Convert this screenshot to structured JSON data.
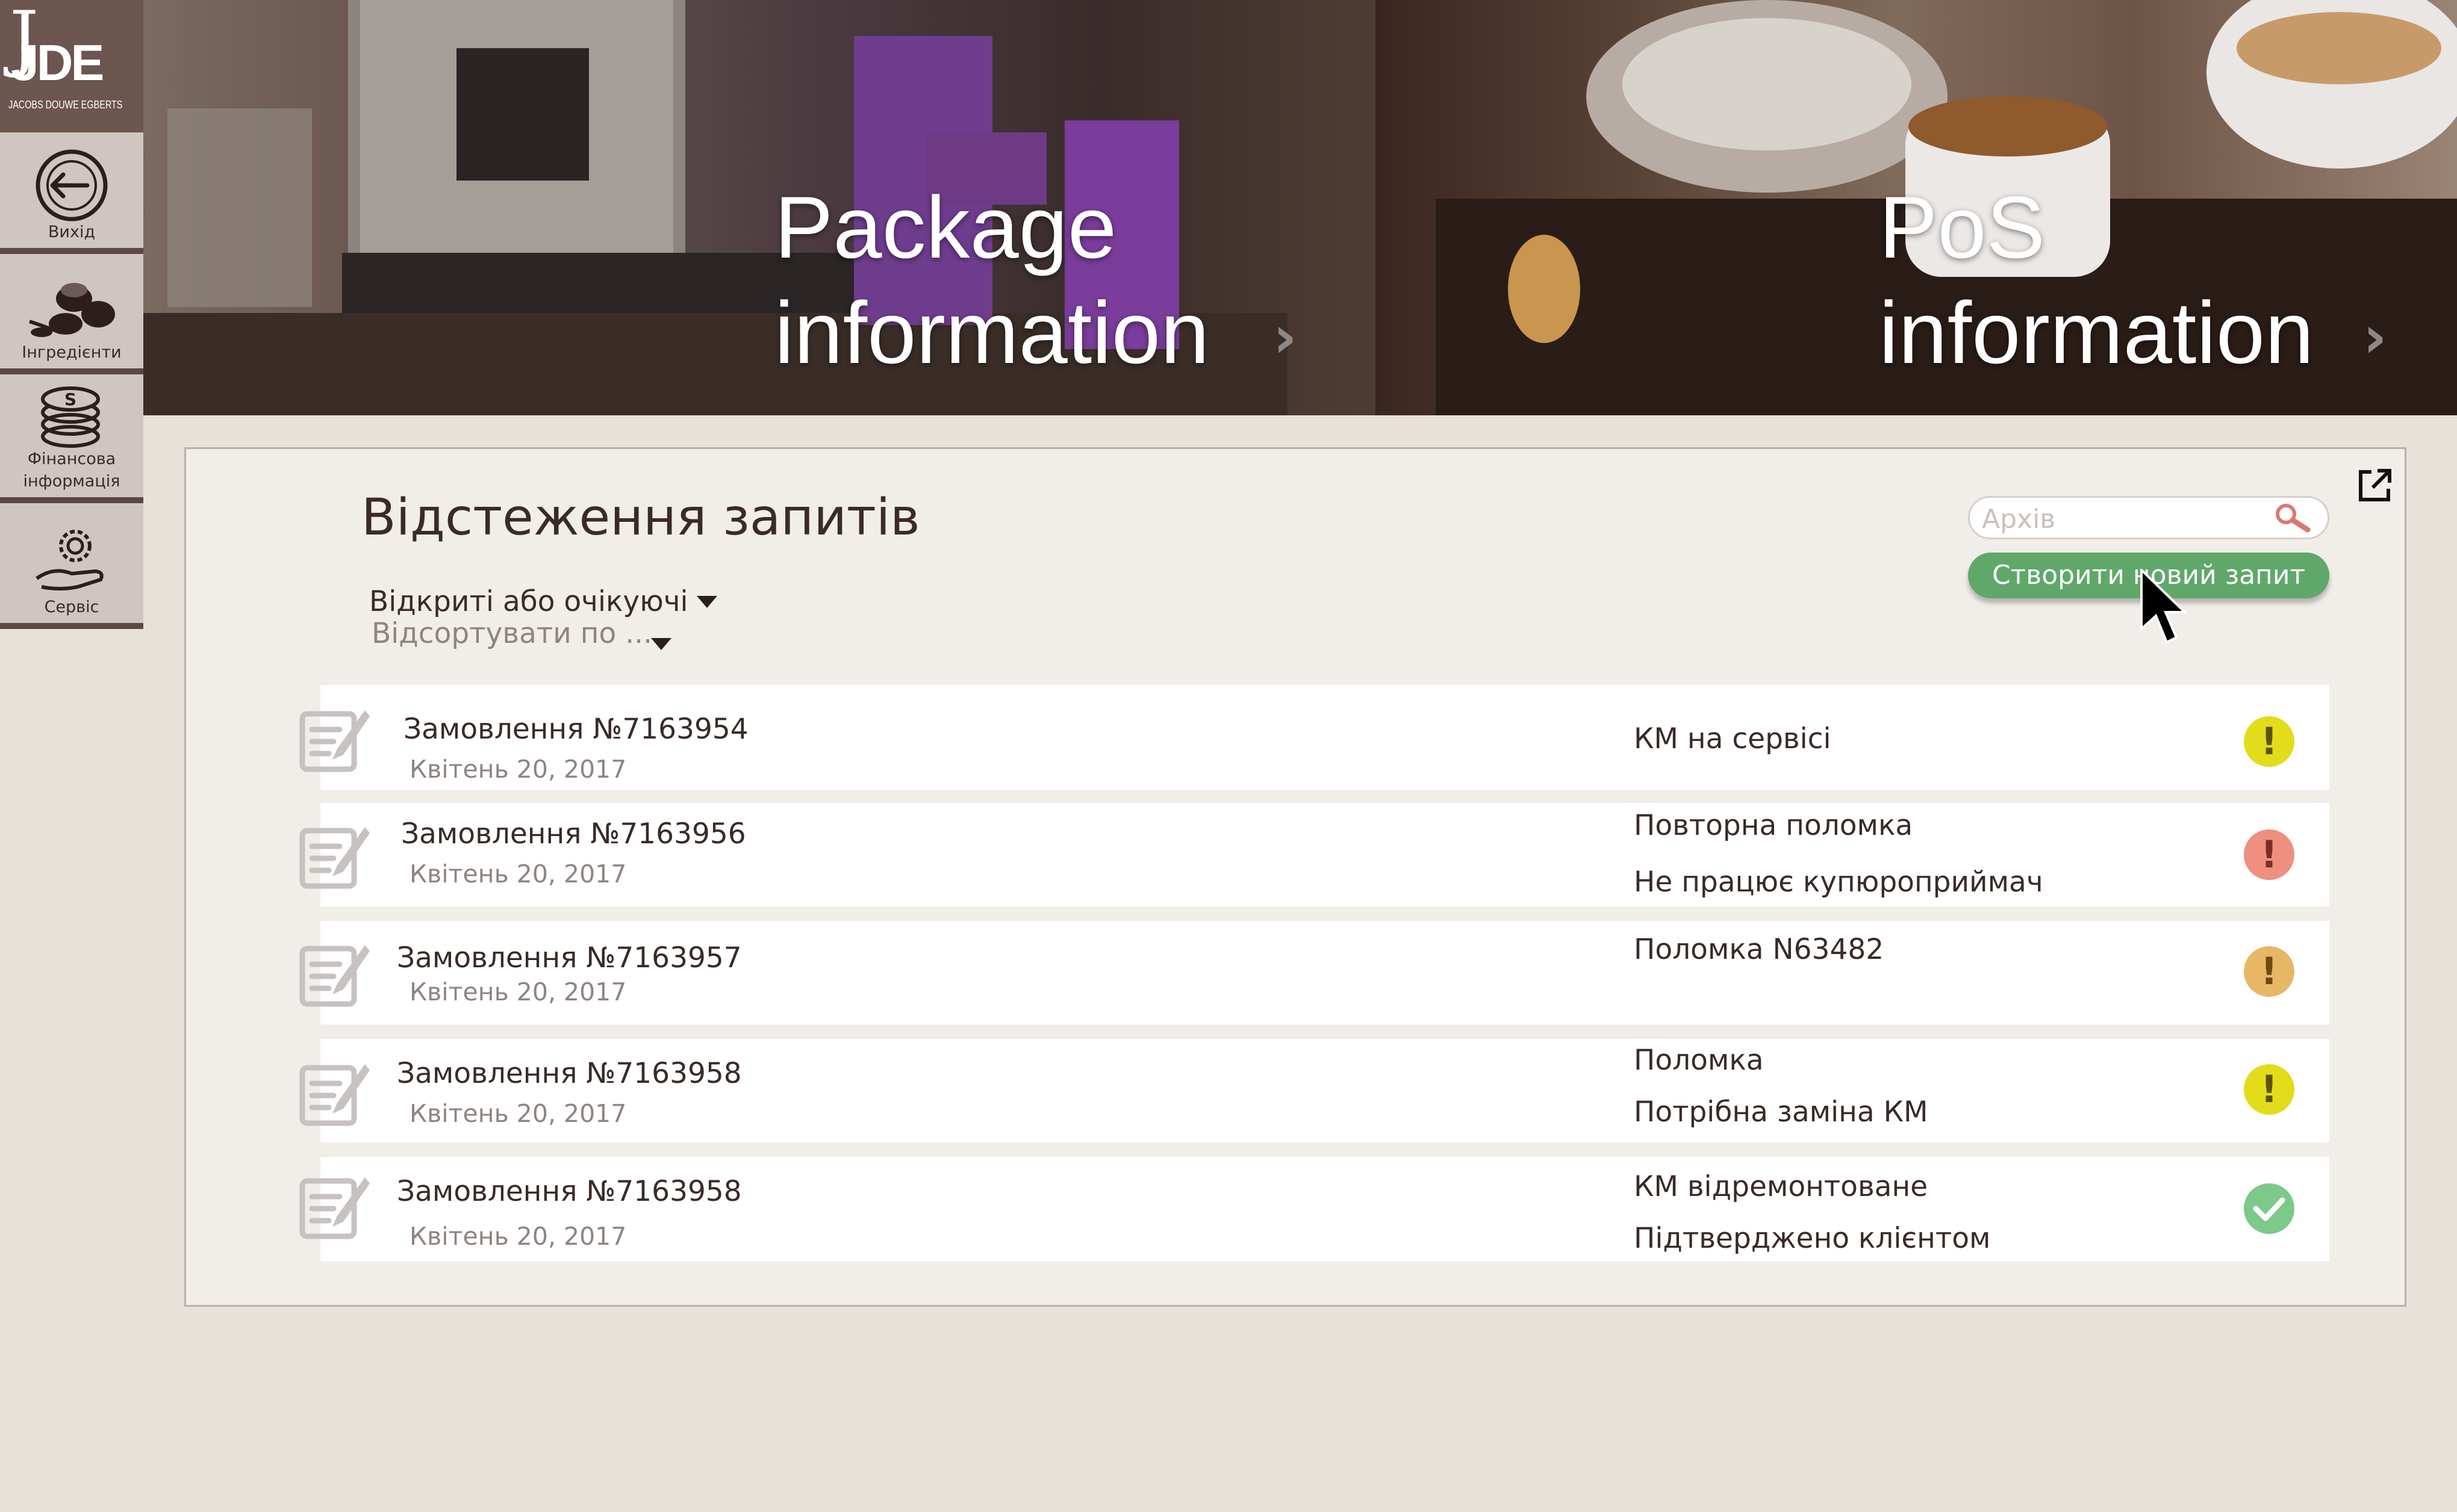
{
  "brand": {
    "logo_text": "JDE",
    "logo_subtitle": "JACOBS DOUWE EGBERTS"
  },
  "sidebar": {
    "items": [
      {
        "label": "Вихід",
        "icon": "exit-icon"
      },
      {
        "label": "Інгредієнти",
        "icon": "ingredients-icon"
      },
      {
        "label": "Фінансова інформація",
        "icon": "coins-icon"
      },
      {
        "label": "Сервіс",
        "icon": "service-gear-icon"
      }
    ]
  },
  "banners": {
    "package": {
      "line1": "Package",
      "line2": "information"
    },
    "pos": {
      "line1": "PoS",
      "line2": "information"
    }
  },
  "page": {
    "title": "Відстеження запитів",
    "filter_status": "Відкриті або очікуючі",
    "sort_placeholder": "Відсортувати по ..."
  },
  "search": {
    "placeholder": "Архів"
  },
  "actions": {
    "new_request_label": "Створити новий запит"
  },
  "colors": {
    "warning_yellow": "#e3dc1a",
    "error_red": "#ee8f80",
    "warning_orange": "#e8b766",
    "success_green": "#7cc98a",
    "button_green": "#5fa86a",
    "sidebar_dark": "#6d5550"
  },
  "requests": [
    {
      "order": "Замовлення №7163954",
      "date": "Квітень 20, 2017",
      "status": [
        "КМ на сервісі"
      ],
      "badge": "warning-yellow"
    },
    {
      "order": "Замовлення №7163956",
      "date": "Квітень 20, 2017",
      "status": [
        "Повторна поломка",
        "Не працює купюроприймач"
      ],
      "badge": "error-red"
    },
    {
      "order": "Замовлення №7163957",
      "date": "Квітень 20, 2017",
      "status": [
        "Поломка N63482"
      ],
      "badge": "warning-orange"
    },
    {
      "order": "Замовлення №7163958",
      "date": "Квітень 20, 2017",
      "status": [
        "Поломка",
        "Потрібна заміна КМ"
      ],
      "badge": "warning-yellow"
    },
    {
      "order": "Замовлення №7163958",
      "date": "Квітень 20, 2017",
      "status": [
        "КМ відремонтоване",
        "Підтверджено клієнтом"
      ],
      "badge": "success-green"
    }
  ]
}
